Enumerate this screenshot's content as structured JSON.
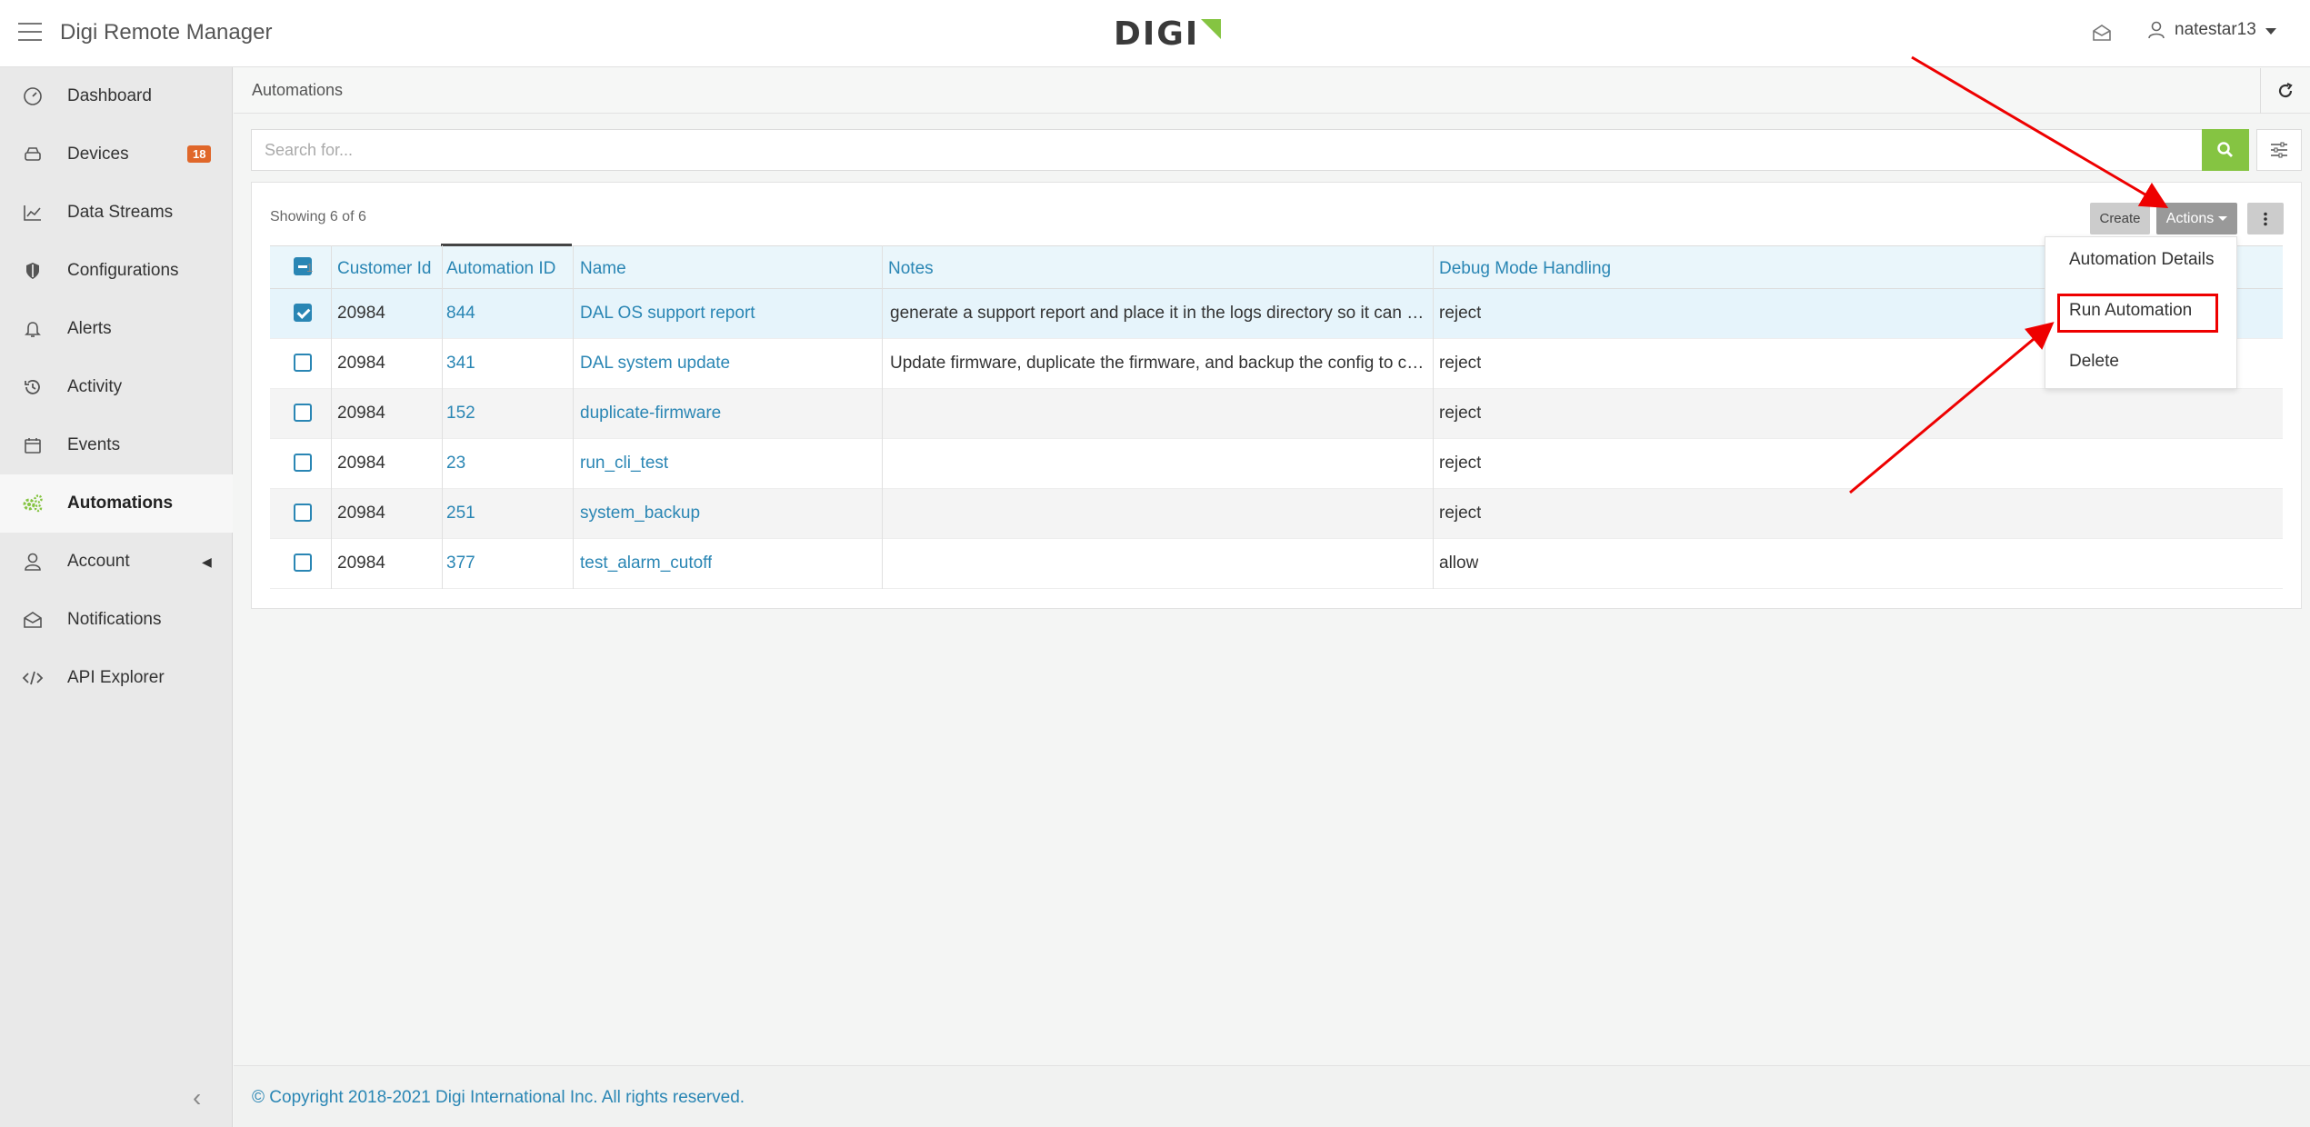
{
  "header": {
    "app_title": "Digi Remote Manager",
    "logo_text": "DIGI",
    "username": "natestar13"
  },
  "sidebar": {
    "items": [
      {
        "label": "Dashboard",
        "icon": "gauge-icon"
      },
      {
        "label": "Devices",
        "icon": "device-icon",
        "badge": "18"
      },
      {
        "label": "Data Streams",
        "icon": "chart-line-icon"
      },
      {
        "label": "Configurations",
        "icon": "shield-icon"
      },
      {
        "label": "Alerts",
        "icon": "bell-icon"
      },
      {
        "label": "Activity",
        "icon": "history-icon"
      },
      {
        "label": "Events",
        "icon": "calendar-icon"
      },
      {
        "label": "Automations",
        "icon": "cogs-icon",
        "active": true
      },
      {
        "label": "Account",
        "icon": "user-icon"
      },
      {
        "label": "Notifications",
        "icon": "envelope-icon"
      },
      {
        "label": "API Explorer",
        "icon": "code-icon"
      }
    ]
  },
  "breadcrumb": "Automations",
  "search": {
    "placeholder": "Search for..."
  },
  "toolbar": {
    "showing": "Showing 6 of 6",
    "create_label": "Create",
    "actions_label": "Actions"
  },
  "table": {
    "selected_count": "1",
    "columns": [
      "Customer Id",
      "Automation ID",
      "Name",
      "Notes",
      "Debug Mode Handling"
    ],
    "rows": [
      {
        "checked": true,
        "customer_id": "20984",
        "automation_id": "844",
        "name": "DAL OS support report",
        "notes": "generate a support report and place it in the logs directory so it can be r…",
        "debug": "reject"
      },
      {
        "checked": false,
        "customer_id": "20984",
        "automation_id": "341",
        "name": "DAL system update",
        "notes": "Update firmware, duplicate the firmware, and backup the config to crea…",
        "debug": "reject"
      },
      {
        "checked": false,
        "customer_id": "20984",
        "automation_id": "152",
        "name": "duplicate-firmware",
        "notes": "",
        "debug": "reject"
      },
      {
        "checked": false,
        "customer_id": "20984",
        "automation_id": "23",
        "name": "run_cli_test",
        "notes": "",
        "debug": "reject"
      },
      {
        "checked": false,
        "customer_id": "20984",
        "automation_id": "251",
        "name": "system_backup",
        "notes": "",
        "debug": "reject"
      },
      {
        "checked": false,
        "customer_id": "20984",
        "automation_id": "377",
        "name": "test_alarm_cutoff",
        "notes": "",
        "debug": "allow"
      }
    ]
  },
  "actions_menu": {
    "items": [
      "Automation Details",
      "Run Automation",
      "Delete"
    ]
  },
  "footer": {
    "copyright": "© Copyright 2018-2021 Digi International Inc. All rights reserved."
  },
  "colors": {
    "accent": "#85c442",
    "link": "#2a86b4",
    "badge": "#e0672a",
    "annotation": "#ee0000"
  }
}
